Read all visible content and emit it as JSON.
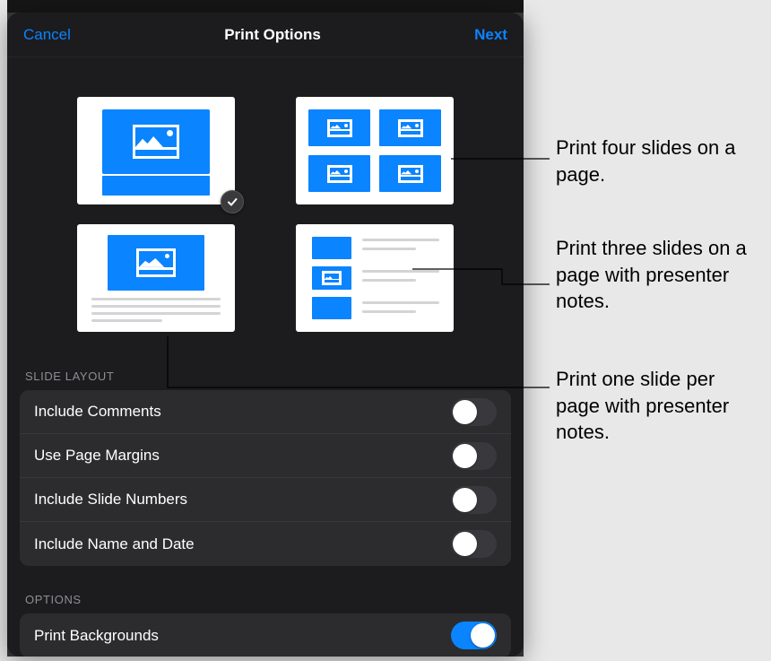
{
  "nav": {
    "cancel": "Cancel",
    "title": "Print Options",
    "next": "Next"
  },
  "layouts": {
    "selected_index": 0,
    "options": [
      {
        "id": "full-slide"
      },
      {
        "id": "four-up"
      },
      {
        "id": "slide-with-notes"
      },
      {
        "id": "three-with-notes"
      }
    ]
  },
  "sections": {
    "slide_layout_header": "SLIDE LAYOUT",
    "options_header": "OPTIONS"
  },
  "slide_layout_rows": [
    {
      "label": "Include Comments",
      "on": false
    },
    {
      "label": "Use Page Margins",
      "on": false
    },
    {
      "label": "Include Slide Numbers",
      "on": false
    },
    {
      "label": "Include Name and Date",
      "on": false
    }
  ],
  "options_rows": [
    {
      "label": "Print Backgrounds",
      "on": true
    }
  ],
  "callouts": {
    "c1": "Print four slides on a page.",
    "c2": "Print three slides on a page with presenter notes.",
    "c3": "Print one slide per page with presenter notes."
  },
  "colors": {
    "accent": "#0a84ff"
  }
}
